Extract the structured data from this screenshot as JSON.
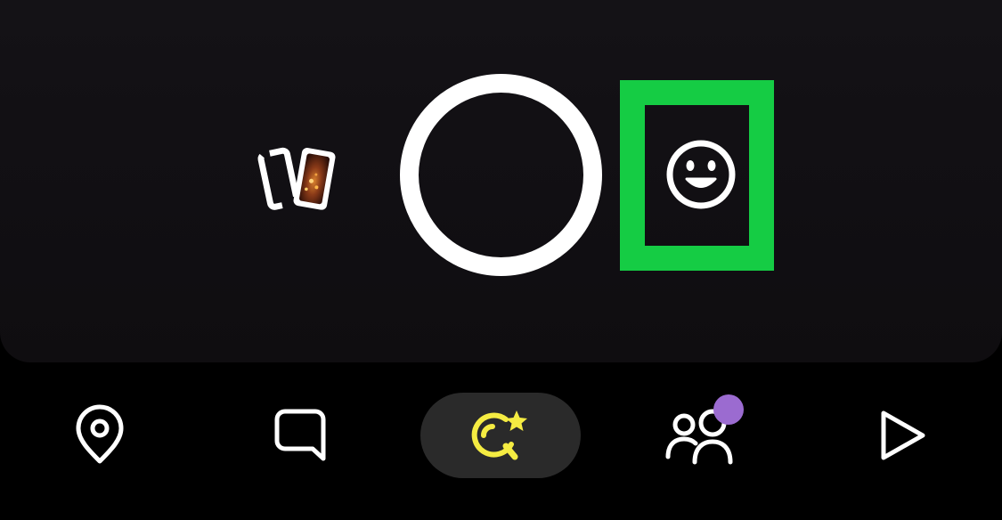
{
  "screen": "camera",
  "camera": {
    "memories": {
      "icon": "memories-cards-icon"
    },
    "shutter": {
      "icon": "shutter-ring"
    },
    "lens": {
      "icon": "smiley-face-icon"
    },
    "highlight_color": "#15cc44"
  },
  "nav": {
    "items": [
      {
        "icon": "map-pin-icon",
        "selected": false
      },
      {
        "icon": "chat-bubble-icon",
        "selected": false
      },
      {
        "icon": "spotlight-search-icon",
        "selected": true,
        "color": "#f5ec42"
      },
      {
        "icon": "friends-stories-icon",
        "selected": false,
        "badge_color": "#9b6bd0"
      },
      {
        "icon": "play-triangle-icon",
        "selected": false
      }
    ]
  },
  "colors": {
    "background": "#000000",
    "camera_bg": "#121014",
    "icon": "#ffffff",
    "accent": "#f5ec42",
    "pill": "#2a2a2a"
  }
}
